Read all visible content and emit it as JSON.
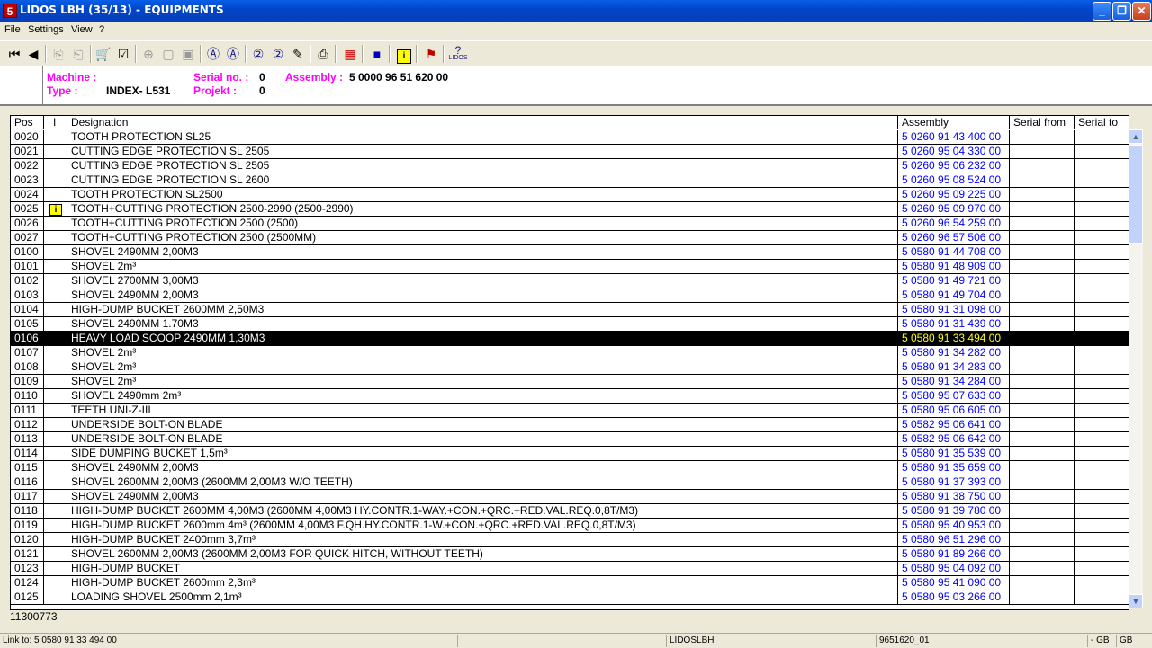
{
  "window": {
    "icon_text": "5",
    "title": "LIDOS LBH  (35/13) - EQUIPMENTS",
    "min": "_",
    "max": "❐",
    "close": "✕"
  },
  "menu": {
    "file": "File",
    "settings": "Settings",
    "view": "View",
    "help": "?"
  },
  "toolbar": {
    "first": "⏮",
    "prev": "◀",
    "lidos": "LIDOS"
  },
  "info": {
    "machine_label": "Machine  :",
    "machine_value": "",
    "type_label": "Type   :",
    "type_value": "INDEX- L531",
    "serial_label": "Serial no.  :",
    "serial_value": "0",
    "projekt_label": "Projekt :",
    "projekt_value": "0",
    "assembly_label": "Assembly  :",
    "assembly_value": "5 0000  96 51 620 00"
  },
  "grid": {
    "headers": {
      "pos": "Pos",
      "i": "I",
      "designation": "Designation",
      "assembly": "Assembly",
      "serial_from": "Serial from",
      "serial_to": "Serial to"
    },
    "info_icon": "i",
    "rows": [
      {
        "pos": "0020",
        "designation": "TOOTH PROTECTION SL25",
        "assembly": "5 0260  91 43 400 00"
      },
      {
        "pos": "0021",
        "designation": "CUTTING EDGE PROTECTION SL 2505",
        "assembly": "5 0260  95 04 330 00"
      },
      {
        "pos": "0022",
        "designation": "CUTTING EDGE PROTECTION SL 2505",
        "assembly": "5 0260  95 06 232 00"
      },
      {
        "pos": "0023",
        "designation": "CUTTING EDGE PROTECTION SL 2600",
        "assembly": "5 0260  95 08 524 00"
      },
      {
        "pos": "0024",
        "designation": "TOOTH PROTECTION SL2500",
        "assembly": "5 0260  95 09 225 00"
      },
      {
        "pos": "0025",
        "designation": "TOOTH+CUTTING PROTECTION 2500-2990 (2500-2990)",
        "assembly": "5 0260  95 09 970 00",
        "info": true
      },
      {
        "pos": "0026",
        "designation": "TOOTH+CUTTING PROTECTION 2500 (2500)",
        "assembly": "5 0260  96 54 259 00"
      },
      {
        "pos": "0027",
        "designation": "TOOTH+CUTTING PROTECTION 2500 (2500MM)",
        "assembly": "5 0260  96 57 506 00"
      },
      {
        "pos": "0100",
        "designation": "SHOVEL 2490MM 2,00M3",
        "assembly": "5 0580  91 44 708 00"
      },
      {
        "pos": "0101",
        "designation": "SHOVEL  2m³",
        "assembly": "5 0580  91 48 909 00"
      },
      {
        "pos": "0102",
        "designation": "SHOVEL 2700MM 3,00M3",
        "assembly": "5 0580  91 49 721 00"
      },
      {
        "pos": "0103",
        "designation": "SHOVEL 2490MM 2,00M3",
        "assembly": "5 0580  91 49 704 00"
      },
      {
        "pos": "0104",
        "designation": "HIGH-DUMP BUCKET 2600MM 2,50M3",
        "assembly": "5 0580  91 31 098 00"
      },
      {
        "pos": "0105",
        "designation": "SHOVEL 2490MM 1.70M3",
        "assembly": "5 0580  91 31 439 00"
      },
      {
        "pos": "0106",
        "designation": "HEAVY LOAD SCOOP 2490MM 1,30M3",
        "assembly": "5 0580  91 33 494 00",
        "selected": true
      },
      {
        "pos": "0107",
        "designation": "SHOVEL  2m³",
        "assembly": "5 0580  91 34 282 00"
      },
      {
        "pos": "0108",
        "designation": "SHOVEL  2m³",
        "assembly": "5 0580  91 34 283 00"
      },
      {
        "pos": "0109",
        "designation": "SHOVEL  2m³",
        "assembly": "5 0580  91 34 284 00"
      },
      {
        "pos": "0110",
        "designation": "SHOVEL  2490mm 2m³",
        "assembly": "5 0580  95 07 633 00"
      },
      {
        "pos": "0111",
        "designation": "TEETH UNI-Z-III",
        "assembly": "5 0580  95 06 605 00"
      },
      {
        "pos": "0112",
        "designation": "UNDERSIDE BOLT-ON BLADE",
        "assembly": "5 0582  95 06 641 00"
      },
      {
        "pos": "0113",
        "designation": "UNDERSIDE BOLT-ON BLADE",
        "assembly": "5 0582  95 06 642 00"
      },
      {
        "pos": "0114",
        "designation": "SIDE DUMPING BUCKET  1,5m³",
        "assembly": "5 0580  91 35 539 00"
      },
      {
        "pos": "0115",
        "designation": "SHOVEL 2490MM 2,00M3",
        "assembly": "5 0580  91 35 659 00"
      },
      {
        "pos": "0116",
        "designation": "SHOVEL 2600MM 2,00M3 (2600MM 2,00M3 W/O TEETH)",
        "assembly": "5 0580  91 37 393 00"
      },
      {
        "pos": "0117",
        "designation": "SHOVEL 2490MM 2,00M3",
        "assembly": "5 0580  91 38 750 00"
      },
      {
        "pos": "0118",
        "designation": "HIGH-DUMP BUCKET 2600MM 4,00M3 (2600MM 4,00M3 HY.CONTR.1-WAY.+CON.+QRC.+RED.VAL.REQ.0,8T/M3)",
        "assembly": "5 0580  91 39 780 00"
      },
      {
        "pos": "0119",
        "designation": "HIGH-DUMP BUCKET  2600mm 4m³ (2600MM 4,00M3 F.QH.HY.CONTR.1-W.+CON.+QRC.+RED.VAL.REQ.0,8T/M3)",
        "assembly": "5 0580  95 40 953 00"
      },
      {
        "pos": "0120",
        "designation": "HIGH-DUMP BUCKET  2400mm 3,7m³",
        "assembly": "5 0580  96 51 296 00"
      },
      {
        "pos": "0121",
        "designation": "SHOVEL 2600MM 2,00M3 (2600MM 2,00M3 FOR QUICK HITCH, WITHOUT TEETH)",
        "assembly": "5 0580  91 89 266 00"
      },
      {
        "pos": "0123",
        "designation": "HIGH-DUMP BUCKET",
        "assembly": "5 0580  95 04 092 00"
      },
      {
        "pos": "0124",
        "designation": "HIGH-DUMP BUCKET  2600mm 2,3m³",
        "assembly": "5 0580  95 41 090 00"
      },
      {
        "pos": "0125",
        "designation": "LOADING SHOVEL  2500mm 2,1m³",
        "assembly": "5 0580  95 03 266 00"
      }
    ]
  },
  "footer": {
    "number": "11300773"
  },
  "status": {
    "link": "Link to: 5 0580  91 33 494 00",
    "db": "LIDOSLBH",
    "doc": "9651620_01",
    "lang1": "- GB",
    "lang2": "GB"
  }
}
